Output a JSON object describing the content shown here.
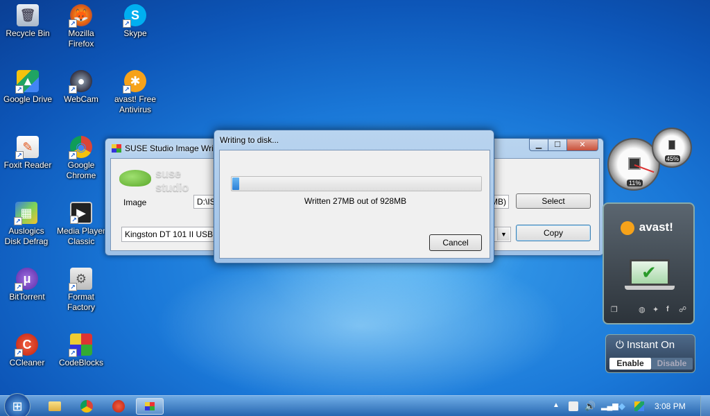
{
  "desktop": {
    "icons": [
      {
        "label": "Recycle Bin",
        "glyph": "🗑"
      },
      {
        "label": "Mozilla Firefox",
        "glyph": "🦊"
      },
      {
        "label": "Skype",
        "glyph": "S"
      },
      {
        "label": "Google Drive",
        "glyph": "▲"
      },
      {
        "label": "WebCam",
        "glyph": "●"
      },
      {
        "label": "avast! Free Antivirus",
        "glyph": "✱"
      },
      {
        "label": "Foxit Reader",
        "glyph": "✎"
      },
      {
        "label": "Google Chrome",
        "glyph": "◉"
      },
      {
        "label": "Auslogics Disk Defrag",
        "glyph": "▦"
      },
      {
        "label": "Media Player Classic",
        "glyph": "▶"
      },
      {
        "label": "BitTorrent",
        "glyph": "μ"
      },
      {
        "label": "Format Factory",
        "glyph": "⚙"
      },
      {
        "label": "CCleaner",
        "glyph": "C"
      },
      {
        "label": "CodeBlocks",
        "glyph": "■"
      }
    ]
  },
  "imageWriter": {
    "title": "SUSE Studio Image Writ",
    "logo_text": "suse studio",
    "image_label": "Image",
    "image_path": "D:\\ISO",
    "image_size_suffix": "MB)",
    "select_label": "Select",
    "device_value": "Kingston DT 101 II USB De",
    "copy_label": "Copy",
    "minimize": "▁",
    "maximize": "☐",
    "close": "✕"
  },
  "progressDialog": {
    "title": "Writing to disk...",
    "progress_fraction": 0.0291,
    "status": "Written 27MB out of 928MB",
    "cancel_label": "Cancel"
  },
  "gadgets": {
    "cpu_meter": {
      "cpu": "11%",
      "memory": "45%"
    },
    "avast": {
      "logo": "avast!",
      "instant_on": "Instant On",
      "enable": "Enable",
      "disable": "Disable"
    }
  },
  "taskbar": {
    "clock": "3:08 PM",
    "start_glyph": "⊞"
  },
  "colors": {
    "progress": "#3a8ee6",
    "avast_orange": "#f6a21a"
  }
}
